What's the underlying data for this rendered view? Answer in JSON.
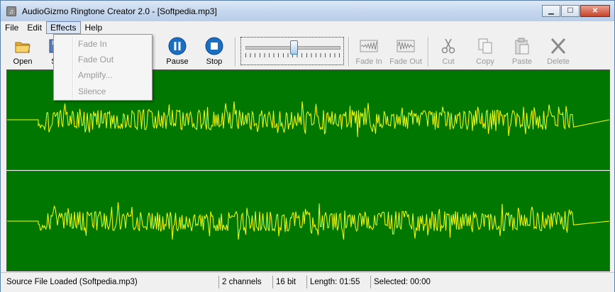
{
  "window": {
    "title": "AudioGizmo Ringtone Creator 2.0 - [Softpedia.mp3]",
    "icon": "music-note-icon",
    "caption_buttons": [
      "minimize-icon",
      "maximize-icon",
      "close-icon"
    ]
  },
  "menu": {
    "items": [
      {
        "label": "File"
      },
      {
        "label": "Edit"
      },
      {
        "label": "Effects",
        "open": true
      },
      {
        "label": "Help"
      }
    ]
  },
  "effects_menu": {
    "items": [
      {
        "label": "Fade In",
        "enabled": false
      },
      {
        "label": "Fade Out",
        "enabled": false
      },
      {
        "label": "Amplify...",
        "enabled": false
      },
      {
        "label": "Silence",
        "enabled": false
      }
    ]
  },
  "toolbar": {
    "open": {
      "label": "Open",
      "icon": "open-folder-icon"
    },
    "save": {
      "label": "Sa",
      "icon": "save-icon"
    },
    "pause": {
      "label": "Pause",
      "icon": "pause-icon"
    },
    "stop": {
      "label": "Stop",
      "icon": "stop-icon"
    },
    "volume": {
      "level": 0.5
    },
    "fade_in": {
      "label": "Fade In",
      "icon": "fade-in-icon",
      "enabled": false
    },
    "fade_out": {
      "label": "Fade Out",
      "icon": "fade-out-icon",
      "enabled": false
    },
    "cut": {
      "label": "Cut",
      "icon": "scissors-icon",
      "enabled": false
    },
    "copy": {
      "label": "Copy",
      "icon": "copy-icon",
      "enabled": false
    },
    "paste": {
      "label": "Paste",
      "icon": "paste-icon",
      "enabled": false
    },
    "delete": {
      "label": "Delete",
      "icon": "delete-x-icon",
      "enabled": false
    }
  },
  "waveform": {
    "background_color": "#007800",
    "wave_color": "#ffff00",
    "channels": 2
  },
  "statusbar": {
    "status": "Source File Loaded (Softpedia.mp3)",
    "channels": "2 channels",
    "bit_depth": "16 bit",
    "length": "Length: 01:55",
    "selected": "Selected: 00:00"
  },
  "colors": {
    "titlebar": "#c4d7ee",
    "accent": "#1a6fc2"
  }
}
